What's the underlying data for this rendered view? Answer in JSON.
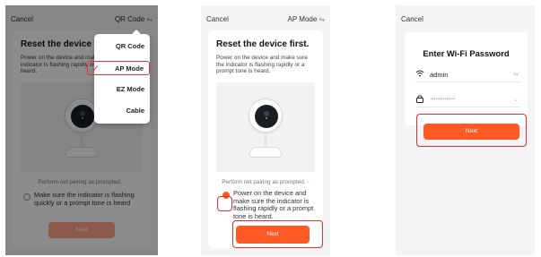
{
  "screen1": {
    "cancel": "Cancel",
    "mode_label": "QR Code",
    "swap_icon": "⇋",
    "title": "Reset the device first.",
    "desc": "Power on the device and make sure the indicator is flashing rapidly or a prompt tone is heard.",
    "pairing": "Perform net pairing as prompted.",
    "confirm": "Make sure the indicator is flashing quickly or a prompt tone is heard",
    "next": "Next",
    "menu": [
      "QR Code",
      "AP Mode",
      "EZ Mode",
      "Cable"
    ],
    "selected_menu": "AP Mode"
  },
  "screen2": {
    "cancel": "Cancel",
    "mode_label": "AP Mode",
    "swap_icon": "⇋",
    "title": "Reset the device first.",
    "desc": "Power on the device and make sure the indicator is flashing rapidly or a prompt tone is heard.",
    "pairing": "Perform net pairing as prompted.",
    "confirm": "Power on the device and make sure the indicator is flashing rapidly or a prompt tone is heard.",
    "next": "Next"
  },
  "screen3": {
    "cancel": "Cancel",
    "title": "Enter Wi-Fi Password",
    "ssid": "admin",
    "password_mask": "··············",
    "swap_icon": "⇋",
    "next": "Next"
  },
  "colors": {
    "accent": "#ff5a26",
    "highlight": "#e03030"
  }
}
